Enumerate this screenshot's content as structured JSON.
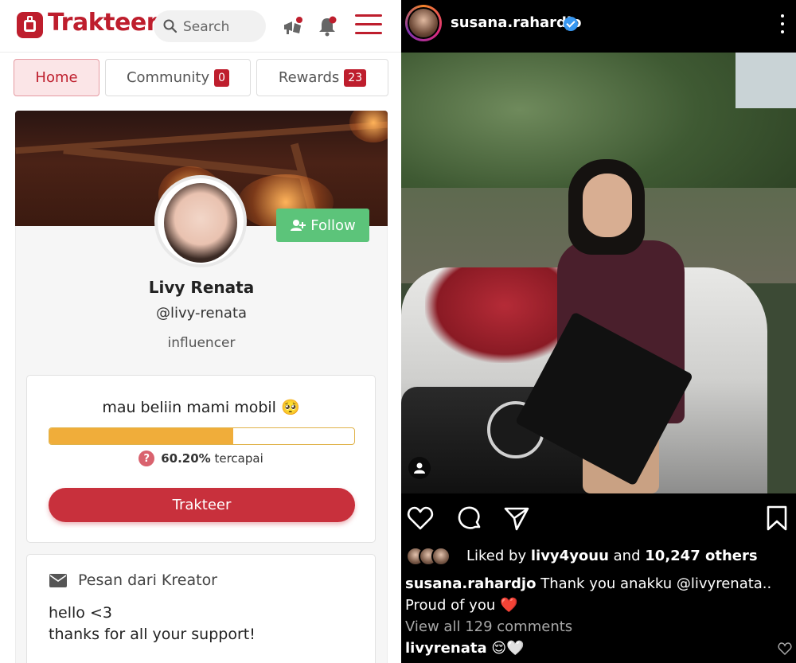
{
  "trakteer": {
    "logo_text": "Trakteer",
    "search": {
      "placeholder": "Search"
    },
    "tabs": [
      {
        "label": "Home"
      },
      {
        "label": "Community",
        "badge": "0"
      },
      {
        "label": "Rewards",
        "badge": "23"
      }
    ],
    "profile": {
      "name": "Livy Renata",
      "handle": "@livy-renata",
      "category": "influencer",
      "follow_label": "Follow"
    },
    "goal": {
      "title": "mau beliin mami mobil 🥺",
      "progress_percent": 60.2,
      "percent_label": "60.20%",
      "status_label": "tercapai",
      "button_label": "Trakteer"
    },
    "message": {
      "header": "Pesan dari Kreator",
      "line1": "hello <3",
      "line2": "thanks for all your support!"
    }
  },
  "instagram": {
    "username": "susana.rahardjo",
    "liked_by_prefix": "Liked by",
    "liked_by_user": "livy4youu",
    "liked_by_and": "and",
    "liked_by_others": "10,247 others",
    "caption_user": "susana.rahardjo",
    "caption_text": "Thank you anakku @livyrenata.. Proud of you",
    "caption_emoji": "❤️",
    "view_all": "View all 129 comments",
    "comment_user": "livyrenata",
    "comment_text": "😌🤍"
  },
  "colors": {
    "brand": "#be1e2d",
    "follow_green": "#5cc47a",
    "progress": "#f0ad3a",
    "verified_blue": "#3897f0"
  }
}
